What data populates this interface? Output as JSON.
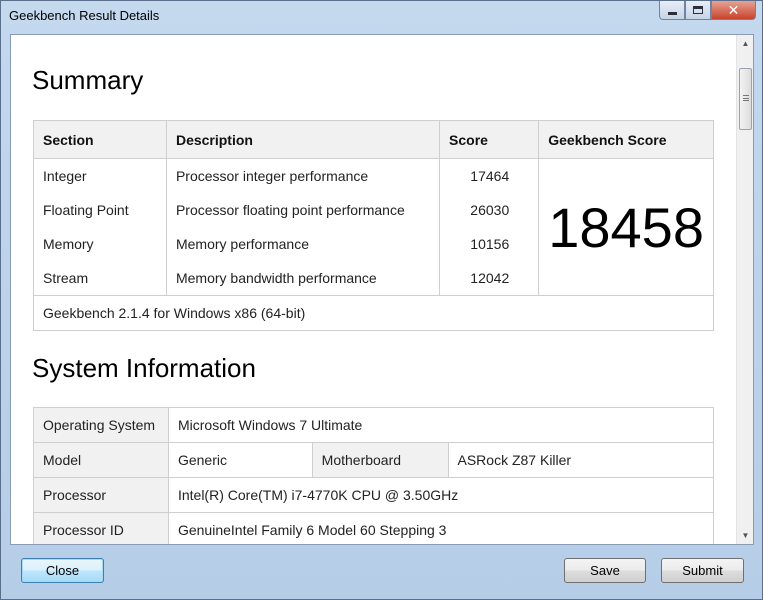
{
  "window": {
    "title": "Geekbench Result Details"
  },
  "summary": {
    "heading": "Summary",
    "headers": {
      "section": "Section",
      "description": "Description",
      "score": "Score",
      "geekbench_score": "Geekbench Score"
    },
    "rows": [
      {
        "section": "Integer",
        "description": "Processor integer performance",
        "score": "17464"
      },
      {
        "section": "Floating Point",
        "description": "Processor floating point performance",
        "score": "26030"
      },
      {
        "section": "Memory",
        "description": "Memory performance",
        "score": "10156"
      },
      {
        "section": "Stream",
        "description": "Memory bandwidth performance",
        "score": "12042"
      }
    ],
    "geekbench_score": "18458",
    "version": "Geekbench 2.1.4 for Windows x86 (64-bit)"
  },
  "system_info": {
    "heading": "System Information",
    "os": {
      "label": "Operating System",
      "value": "Microsoft Windows 7 Ultimate"
    },
    "model": {
      "label": "Model",
      "value": "Generic",
      "motherboard_label": "Motherboard",
      "motherboard_value": "ASRock Z87 Killer"
    },
    "processor": {
      "label": "Processor",
      "value": "Intel(R) Core(TM) i7-4770K CPU @ 3.50GHz"
    },
    "processor_id": {
      "label": "Processor ID",
      "value": "GenuineIntel Family 6 Model 60 Stepping 3"
    }
  },
  "buttons": {
    "close": "Close",
    "save": "Save",
    "submit": "Submit"
  },
  "icons": {
    "minimize": "minimize-icon",
    "maximize": "maximize-icon",
    "close": "close-icon"
  }
}
